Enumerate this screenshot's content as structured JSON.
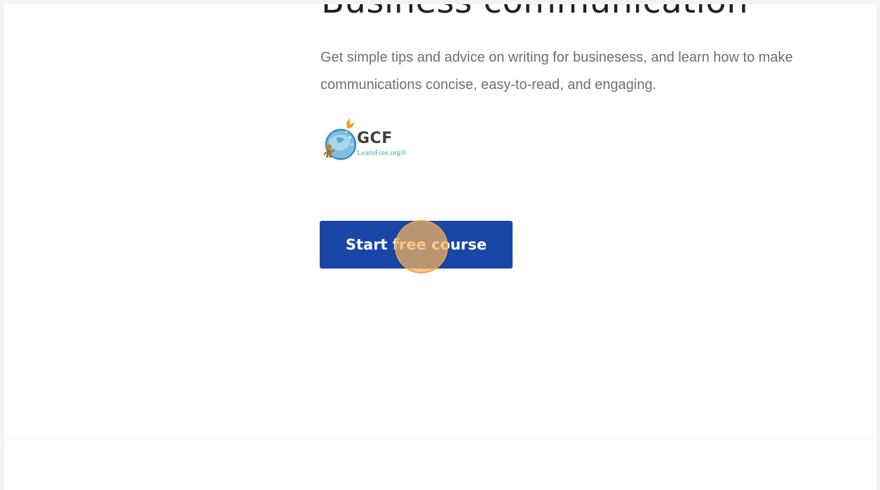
{
  "page": {
    "title": "Business communication",
    "description_line1": "Get simple tips and advice on writing for businesess, and learn how to make",
    "description_line2": "communications concise, easy-to-read, and engaging."
  },
  "provider_logo": {
    "icon": "gcf-learnfree-logo",
    "brand": "GCF",
    "domain": "LearnFree.org®"
  },
  "cta": {
    "label": "Start free course",
    "color": "#1947a8"
  },
  "click_indicator": {
    "color": "#f7b35c"
  }
}
